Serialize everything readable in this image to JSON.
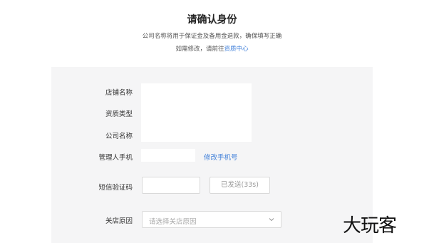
{
  "header": {
    "title": "请确认身份",
    "subtitle_line1": "公司名称将用于保证金及备用金退款，确保填写正确",
    "subtitle_line2_prefix": "如需修改，请前往",
    "subtitle_line2_link": "资质中心"
  },
  "form": {
    "store_name_label": "店铺名称",
    "qualification_type_label": "资质类型",
    "company_name_label": "公司名称",
    "manager_phone_label": "管理人手机",
    "modify_phone_link": "修改手机号",
    "sms_code_label": "短信验证码",
    "sms_code_value": "",
    "send_button_label": "已发送(33s)",
    "close_reason_label": "关店原因",
    "close_reason_placeholder": "请选择关店原因"
  },
  "colors": {
    "link": "#3f7fd9",
    "panel_bg": "#f5f5f6"
  },
  "watermark": {
    "text": "大玩客"
  }
}
